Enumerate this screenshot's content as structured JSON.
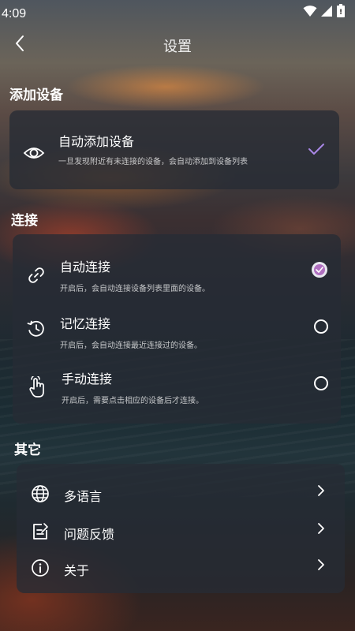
{
  "status_bar": {
    "time": "4:09",
    "icons": [
      "wifi-icon",
      "signal-icon",
      "battery-icon"
    ]
  },
  "header": {
    "title": "设置",
    "back_icon": "back-arrow-icon"
  },
  "sections": {
    "add_device": {
      "title": "添加设备",
      "item": {
        "icon": "eye-icon",
        "label": "自动添加设备",
        "description": "一旦发现附近有未连接的设备，会自动添加到设备列表",
        "checked": true
      }
    },
    "connect": {
      "title": "连接",
      "items": [
        {
          "icon": "link-icon",
          "label": "自动连接",
          "description": "开启后，会自动连接设备列表里面的设备。",
          "selected": true
        },
        {
          "icon": "history-icon",
          "label": "记忆连接",
          "description": "开启后，会自动连接最近连接过的设备。",
          "selected": false
        },
        {
          "icon": "hand-pointer-icon",
          "label": "手动连接",
          "description": "开启后，需要点击相应的设备后才连接。",
          "selected": false
        }
      ]
    },
    "other": {
      "title": "其它",
      "items": [
        {
          "icon": "globe-icon",
          "label": "多语言"
        },
        {
          "icon": "feedback-icon",
          "label": "问题反馈"
        },
        {
          "icon": "info-icon",
          "label": "关于"
        }
      ]
    }
  },
  "colors": {
    "accent": "#b070c0",
    "check": "#a987e6",
    "card_bg": "#262c34"
  }
}
